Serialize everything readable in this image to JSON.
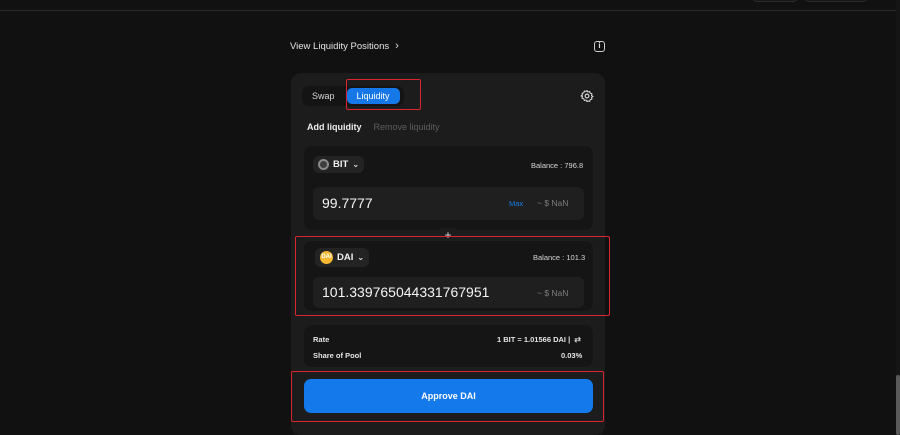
{
  "header": {
    "view_positions_label": "View Liquidity Positions",
    "chevron": "›",
    "info_icon": "i"
  },
  "tabs": {
    "swap_label": "Swap",
    "liquidity_label": "Liquidity",
    "active": "Liquidity"
  },
  "subtabs": {
    "add_label": "Add liquidity",
    "remove_label": "Remove liquidity"
  },
  "token_a": {
    "symbol": "BIT",
    "caret": "⌄",
    "balance": "Balance : 796.8",
    "amount": "99.7777",
    "max_label": "Max",
    "usd_value": "~ $ NaN"
  },
  "plus_symbol": "+",
  "token_b": {
    "symbol": "DAI",
    "icon_text": "DAI",
    "caret": "⌄",
    "balance": "Balance : 101.3",
    "amount": "101.339765044331767951",
    "usd_value": "~ $ NaN"
  },
  "pool_info": {
    "rate_label": "Rate",
    "rate_value": "1 BIT = 1.01566 DAI  |",
    "swap_icon": "⇄",
    "share_label": "Share of Pool",
    "share_value": "0.03%"
  },
  "approve_button": {
    "label": "Approve DAI"
  },
  "colors": {
    "accent": "#1677e8",
    "background": "#111111",
    "card": "#1c1c1c",
    "highlight": "#d9262e",
    "dai_token": "#f4b731"
  }
}
